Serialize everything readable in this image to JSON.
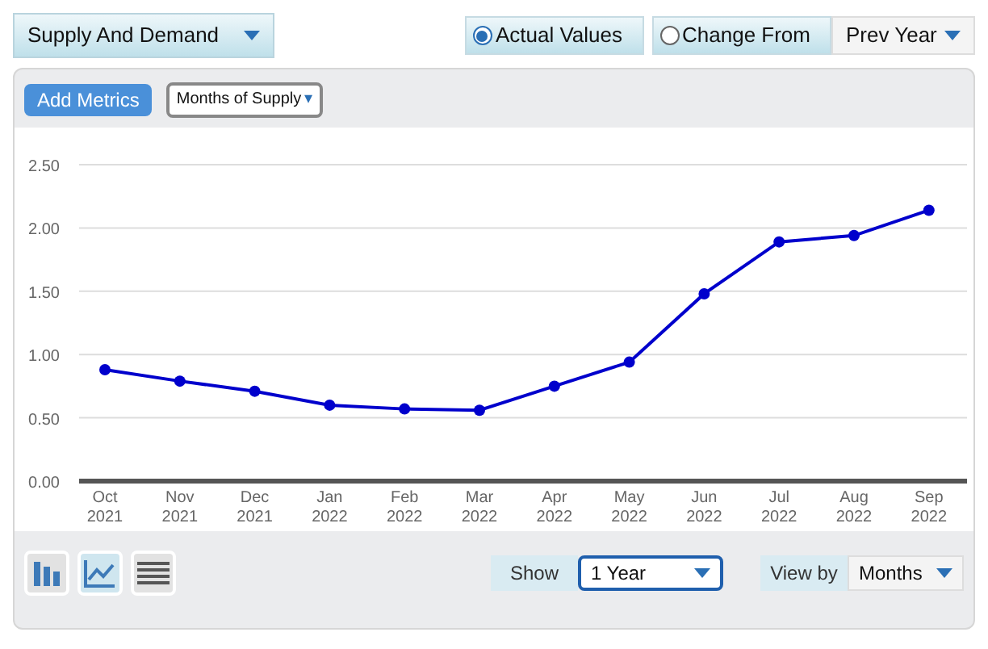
{
  "metric_selector": {
    "value": "Supply And Demand"
  },
  "value_modes": [
    {
      "label": "Actual Values",
      "selected": true
    },
    {
      "label": "Change From",
      "selected": false
    }
  ],
  "compare_period": {
    "value": "Prev Year"
  },
  "toolbar": {
    "add_button": "Add Metrics",
    "dropdown_arrow": "▾"
  },
  "chart_data": {
    "type": "line",
    "grid": true,
    "categories": [
      "Oct\n2021",
      "Nov\n2021",
      "Dec\n2021",
      "Jan\n2022",
      "Feb\n2022",
      "Mar\n2022",
      "Apr\n2022",
      "May\n2022",
      "Jun\n2022",
      "Jul\n2022",
      "Aug\n2022",
      "Sep\n2022"
    ],
    "series": [
      {
        "name": "Months of Supply",
        "color": "#0000cc",
        "marker": "circle",
        "values": [
          0.88,
          0.79,
          0.71,
          0.6,
          0.57,
          0.56,
          0.75,
          0.94,
          1.48,
          1.89,
          1.94,
          2.14
        ]
      }
    ],
    "ylim": [
      0,
      2.5
    ],
    "yticks": [
      {
        "value": 0,
        "label": "0.00"
      },
      {
        "value": 0.5,
        "label": "0.50"
      },
      {
        "value": 1,
        "label": "1.00"
      },
      {
        "value": 1.5,
        "label": "1.50"
      },
      {
        "value": 2,
        "label": "2.00"
      },
      {
        "value": 2.5,
        "label": "2.50"
      }
    ]
  },
  "chart_types": [
    {
      "kind": "bar",
      "selected": false
    },
    {
      "kind": "line",
      "selected": true
    },
    {
      "kind": "table",
      "selected": false
    }
  ],
  "show": {
    "label": "Show",
    "value": "1 Year"
  },
  "view_by": {
    "label": "View by",
    "value": "Months"
  }
}
